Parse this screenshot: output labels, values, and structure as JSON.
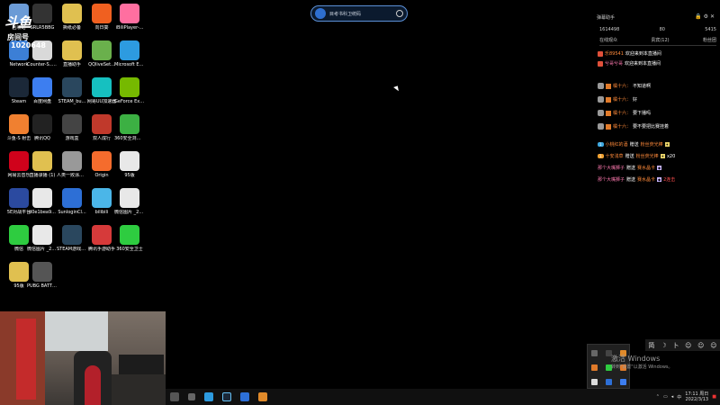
{
  "overlay": {
    "brand": "斗鱼",
    "room_label": "房间号",
    "room_number": "1020648"
  },
  "desktop": {
    "icons": [
      {
        "label": "回收站",
        "color": "#6b9bd6"
      },
      {
        "label": "SRLR5BBG",
        "color": "#333"
      },
      {
        "label": "撕纸必备",
        "color": "#e0c050"
      },
      {
        "label": "向日葵",
        "color": "#f06020"
      },
      {
        "label": "iBiliPlayer-...",
        "color": "#ff6fa0"
      },
      {
        "label": "Network",
        "color": "#3c7fd6"
      },
      {
        "label": "Counter-S... Global Off...",
        "color": "#d9d9d9"
      },
      {
        "label": "直播助手",
        "color": "#e0c050"
      },
      {
        "label": "QQliveSet...",
        "color": "#6ab04c"
      },
      {
        "label": "Microsoft Edge",
        "color": "#2d9be0"
      },
      {
        "label": "Steam",
        "color": "#1b2838"
      },
      {
        "label": "百度网盘",
        "color": "#3d7ef0"
      },
      {
        "label": "STEAM_bu...",
        "color": "#2a475e"
      },
      {
        "label": "网易UU加速器",
        "color": "#16c0c0"
      },
      {
        "label": "GeForce Experience",
        "color": "#76b900"
      },
      {
        "label": "斗鱼-S 射击",
        "color": "#f08030"
      },
      {
        "label": "腾讯QQ",
        "color": "#222"
      },
      {
        "label": "游戏盒",
        "color": "#444"
      },
      {
        "label": "双人成行",
        "color": "#c0392b"
      },
      {
        "label": "360安全浏览器",
        "color": "#3cb043"
      },
      {
        "label": "网易云音乐",
        "color": "#d0021b"
      },
      {
        "label": "直播录播 (1)",
        "color": "#e0c050"
      },
      {
        "label": "人类一败涂地 Human Fa...",
        "color": "#999"
      },
      {
        "label": "Origin",
        "color": "#f56c2d"
      },
      {
        "label": "95版",
        "color": "#e8e8e8"
      },
      {
        "label": "5E对战平台",
        "color": "#2b4aa0"
      },
      {
        "label": "d0e1bea9...",
        "color": "#e8e8e8"
      },
      {
        "label": "SunloginCl...",
        "color": "#2d6fd6"
      },
      {
        "label": "bilibili",
        "color": "#4bb6e8"
      },
      {
        "label": "微信图片 _2021102...",
        "color": "#e8e8e8"
      },
      {
        "label": "微信",
        "color": "#2ecc40"
      },
      {
        "label": "微信图片 _2021091...",
        "color": "#e8e8e8"
      },
      {
        "label": "STEAM游戏管家",
        "color": "#2a475e"
      },
      {
        "label": "腾讯手游助手",
        "color": "#d63a3a"
      },
      {
        "label": "360安全卫士",
        "color": "#2ecc40"
      },
      {
        "label": "95版",
        "color": "#e0c050"
      },
      {
        "label": "PUBG BATTLEGR...",
        "color": "#555"
      }
    ]
  },
  "search": {
    "placeholder": "目考书科卫统码"
  },
  "chat": {
    "title": "弹幕助手",
    "stats": [
      "1614498",
      "80",
      "5415"
    ],
    "tabs": [
      "在线观众",
      "贵宾(12)",
      "粉丝团"
    ],
    "messages": [
      {
        "user": "乐89541",
        "text": "欢迎来到本直播间"
      },
      {
        "user": "兮哥兮哥",
        "text": "欢迎来到本直播间"
      },
      {
        "user": "橘十六：",
        "text": "不知道啊"
      },
      {
        "user": "橘十六：",
        "text": "好"
      },
      {
        "user": "橘十六：",
        "text": "要下播吗"
      },
      {
        "user": "橘十六：",
        "text": "要不要把比赛挂着"
      }
    ],
    "gifts": [
      {
        "level": "1",
        "user": "小桃红的酒",
        "verb": "赠送",
        "gift": "粉丝荧光棒",
        "count": ""
      },
      {
        "level": "1",
        "user": "十安浅草",
        "verb": "赠送",
        "gift": "粉丝荧光棒",
        "count": "x20"
      },
      {
        "level": "",
        "user": "那个大嘴狮子",
        "verb": "赠送",
        "gift": "",
        "count": "赛水晶卡"
      },
      {
        "level": "",
        "user": "那个大嘴狮子",
        "verb": "赠送",
        "gift": "赛水晶卡",
        "count": "2连击"
      }
    ]
  },
  "emote_bar": {
    "items": [
      "简",
      "☽",
      "卜",
      "☺",
      "☺",
      "☺"
    ]
  },
  "activation": {
    "title": "激活 Windows",
    "subtitle": "转到\"设置\"以激活 Windows。"
  },
  "taskbar": {
    "time": "17:11 周日",
    "date": "2022/3/13"
  }
}
